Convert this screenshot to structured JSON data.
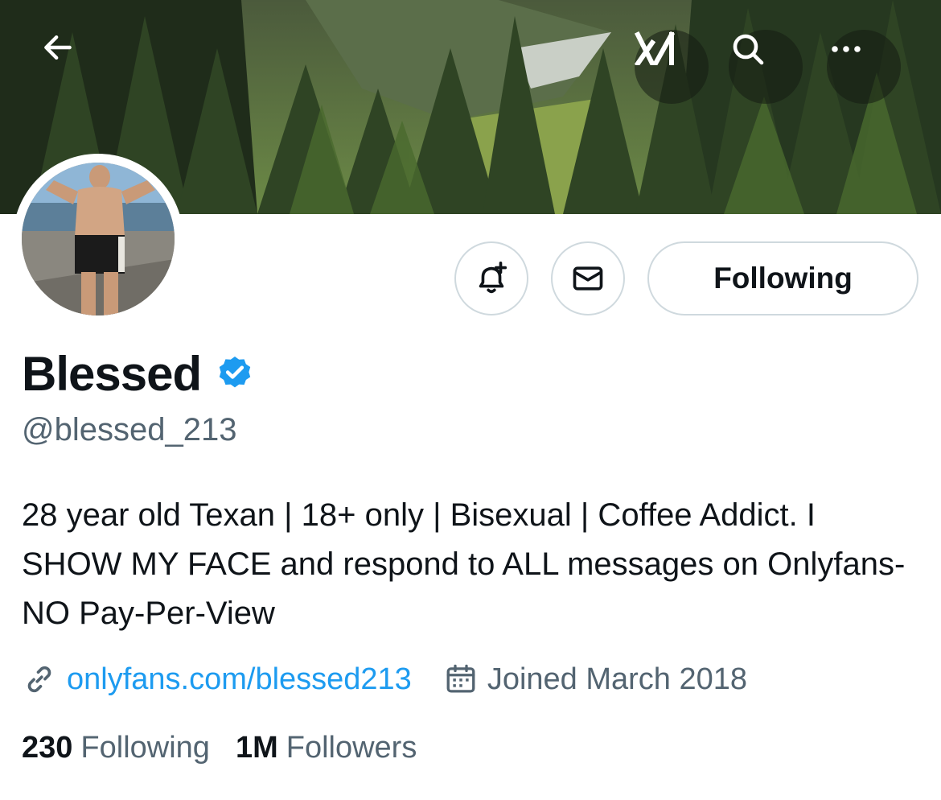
{
  "profile": {
    "display_name": "Blessed",
    "handle": "@blessed_213",
    "bio": "28 year old Texan | 18+ only | Bisexual | Coffee Addict. I SHOW MY FACE and respond to ALL messages on Onlyfans- NO Pay-Per-View",
    "website": "onlyfans.com/blessed213",
    "joined": "Joined March 2018",
    "verified": true
  },
  "actions": {
    "following_label": "Following"
  },
  "stats": {
    "following_count": "230",
    "following_label": "Following",
    "followers_count": "1M",
    "followers_label": "Followers"
  },
  "header": {
    "icons": [
      "back-arrow-icon",
      "grok-icon",
      "search-icon",
      "more-icon"
    ]
  },
  "colors": {
    "link": "#1d9bf0",
    "verified_badge": "#1d9bf0",
    "secondary_text": "#536471",
    "primary_text": "#0f1419",
    "button_border": "#cfd9de"
  }
}
